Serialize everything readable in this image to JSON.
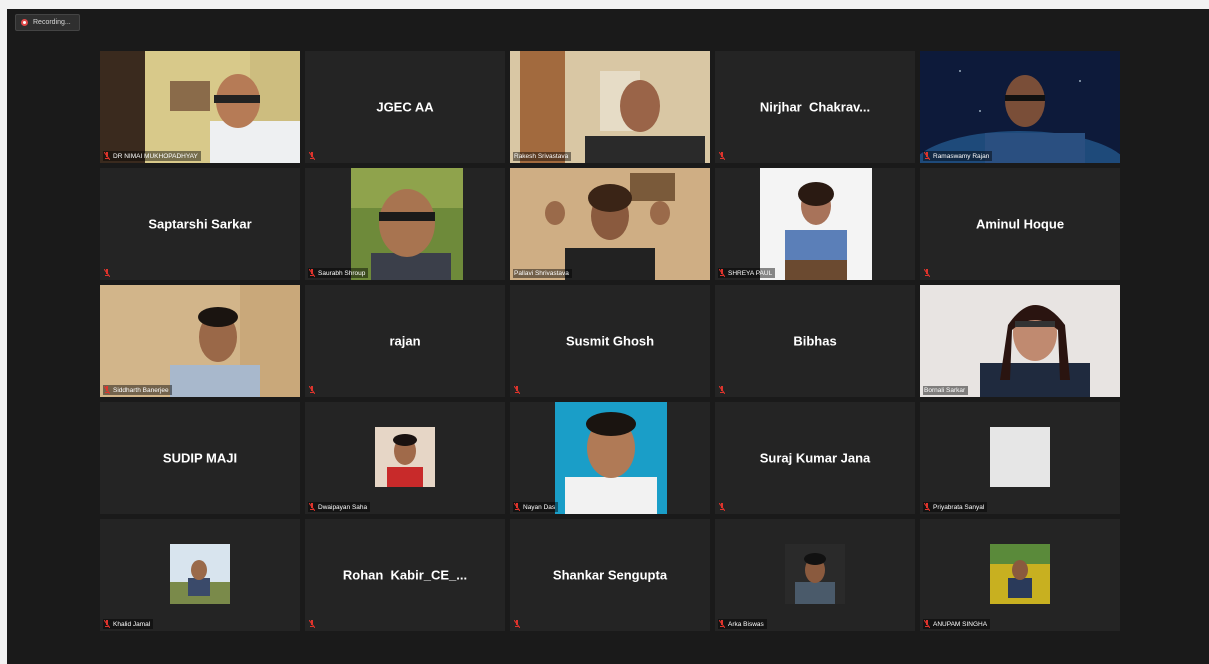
{
  "recording": {
    "label": "Recording..."
  },
  "colors": {
    "mic_muted": "#e0342c",
    "active_border": "#c8e05a",
    "tile_bg": "#242424"
  },
  "participants": [
    {
      "display_label": "DR NIMAI MUKHOPADHYAY",
      "kind": "video"
    },
    {
      "display_name": "JGEC AA",
      "kind": "name"
    },
    {
      "display_label": "Rakesh Srivastava",
      "kind": "video"
    },
    {
      "display_name": "Nirjhar  Chakrav...",
      "kind": "name"
    },
    {
      "display_label": "Ramaswamy Rajan",
      "kind": "video"
    },
    {
      "display_name": "Saptarshi Sarkar",
      "kind": "name"
    },
    {
      "display_label": "Saurabh Shroup",
      "kind": "photo"
    },
    {
      "display_label": "Pallavi Shrivastava",
      "kind": "video",
      "active_speaker": true
    },
    {
      "display_label": "SHREYA PAUL",
      "kind": "photo"
    },
    {
      "display_name": "Aminul Hoque",
      "kind": "name"
    },
    {
      "display_label": "Siddharth Banerjee",
      "kind": "video"
    },
    {
      "display_name": "rajan",
      "kind": "name"
    },
    {
      "display_name": "Susmit Ghosh",
      "kind": "name"
    },
    {
      "display_name": "Bibhas",
      "kind": "name"
    },
    {
      "display_label": "Bornali Sarkar",
      "kind": "video"
    },
    {
      "display_name": "SUDIP MAJI",
      "kind": "name"
    },
    {
      "display_label": "Dwaipayan Saha",
      "kind": "photo"
    },
    {
      "display_label": "Nayan Das",
      "kind": "photo"
    },
    {
      "display_name": "Suraj Kumar Jana",
      "kind": "name"
    },
    {
      "display_label": "Priyabrata Sanyal",
      "kind": "photo"
    },
    {
      "display_label": "Khalid Jamal",
      "kind": "photo"
    },
    {
      "display_name": "Rohan  Kabir_CE_...",
      "kind": "name"
    },
    {
      "display_name": "Shankar Sengupta",
      "kind": "name"
    },
    {
      "display_label": "Arka Biswas",
      "kind": "photo"
    },
    {
      "display_label": "ANUPAM SINGHA",
      "kind": "photo"
    }
  ]
}
